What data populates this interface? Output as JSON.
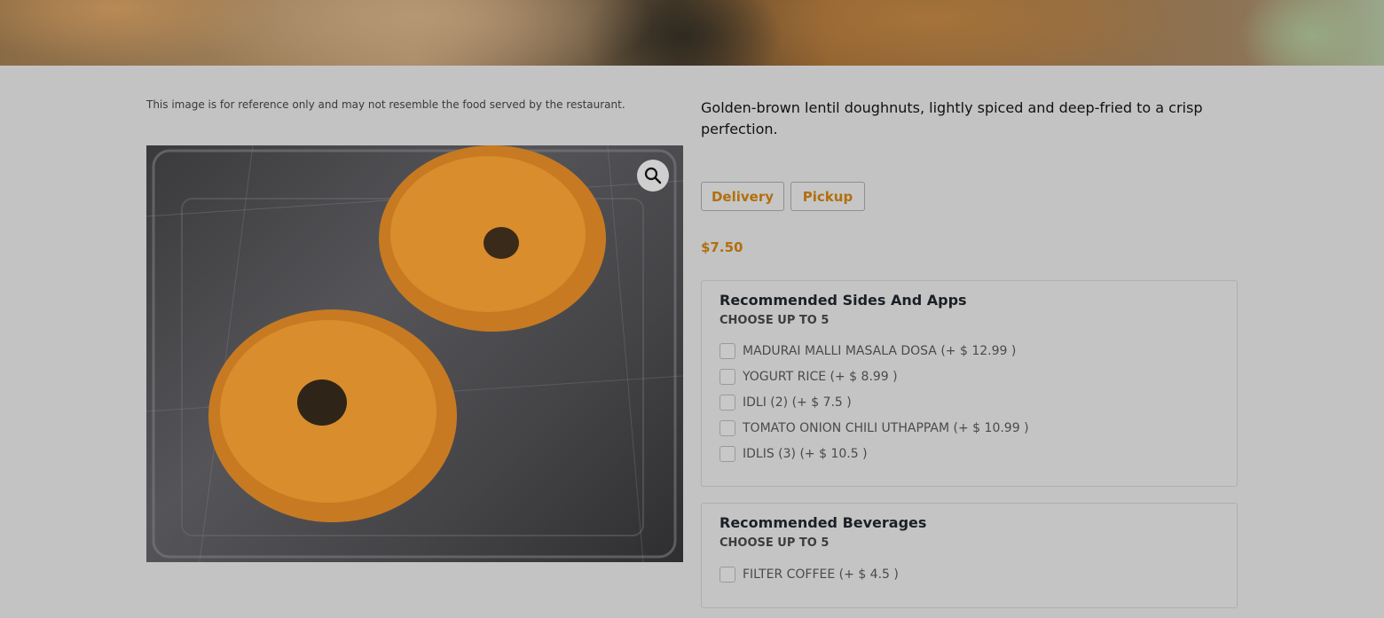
{
  "hero": {
    "description": ""
  },
  "disclaimer": "This image is for reference only and may not resemble the food served by the restaurant.",
  "item": {
    "description": "Golden-brown lentil doughnuts, lightly spiced and deep-fried to a crisp perfection.",
    "price": "$7.50"
  },
  "modes": {
    "delivery": "Delivery",
    "pickup": "Pickup"
  },
  "groups": [
    {
      "title": "Recommended Sides And Apps",
      "subtitle": "CHOOSE UP TO 5",
      "options": [
        "MADURAI MALLI MASALA DOSA (+ $ 12.99 )",
        "YOGURT RICE (+ $ 8.99 )",
        "IDLI (2) (+ $ 7.5 )",
        "TOMATO ONION CHILI UTHAPPAM (+ $ 10.99 )",
        "IDLIS (3) (+ $ 10.5 )"
      ]
    },
    {
      "title": "Recommended Beverages",
      "subtitle": "CHOOSE UP TO 5",
      "options": [
        "FILTER COFFEE (+ $ 4.5 )"
      ]
    }
  ],
  "colors": {
    "accent": "#b26f0d",
    "overlay_bg": "#c3c3c3"
  },
  "icons": {
    "zoom": "magnifier-icon"
  }
}
